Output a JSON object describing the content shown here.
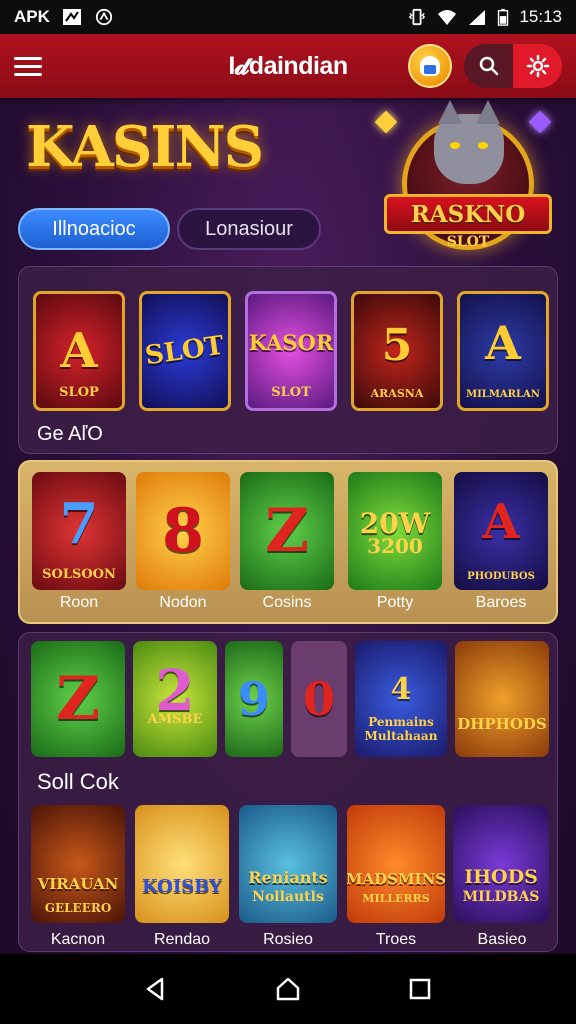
{
  "status_bar": {
    "carrier": "APK",
    "time": "15:13"
  },
  "app_bar": {
    "brand": "I𝓭daindian"
  },
  "hero": {
    "title": "KASINS",
    "tabs": [
      {
        "label": "Illnoacioc",
        "active": true
      },
      {
        "label": "Lonasiour",
        "active": false
      }
    ],
    "emblem": {
      "banner": "RASKNO",
      "sub": "SLOT"
    }
  },
  "row1": {
    "tiles": [
      {
        "main": "A",
        "sub": "SLOP"
      },
      {
        "main": "SLOT",
        "sub": ""
      },
      {
        "main": "KASOR",
        "sub": "SLOT"
      },
      {
        "main": "5",
        "sub": "ARASNA"
      },
      {
        "main": "A",
        "sub": "MILMARLAN"
      }
    ],
    "label": "Ge AľO"
  },
  "row2": {
    "tiles": [
      {
        "main": "7",
        "sub": "SOLSOON",
        "caption": "Roon"
      },
      {
        "main": "8",
        "sub": "",
        "caption": "Nodon"
      },
      {
        "main": "Z",
        "sub": "",
        "caption": "Cosins"
      },
      {
        "main": "20W",
        "sub": "3200",
        "caption": "Potty"
      },
      {
        "main": "A",
        "sub": "PHODUBOS",
        "caption": "Baroes"
      }
    ]
  },
  "row3": {
    "tiles": [
      {
        "main": "Z",
        "sub": ""
      },
      {
        "main": "2",
        "sub": "AMSBE"
      },
      {
        "main": "9",
        "sub": ""
      },
      {
        "main": "0",
        "sub": ""
      },
      {
        "main": "4",
        "sub": "Penmains Multahaan"
      },
      {
        "main": "",
        "sub": "DHPHODS"
      }
    ],
    "label": "Soll Cok"
  },
  "row4": {
    "tiles": [
      {
        "main": "VIRAUAN",
        "sub": "GELEERO",
        "caption": "Kacnon"
      },
      {
        "main": "KOISBY",
        "sub": "",
        "caption": "Rendao"
      },
      {
        "main": "Reniants",
        "sub": "Nollautls",
        "caption": "Rosieo"
      },
      {
        "main": "MADSMINS",
        "sub": "MILLERRS",
        "caption": "Troes"
      },
      {
        "main": "IHODS",
        "sub": "MILDBAS",
        "caption": "Basieo"
      }
    ]
  },
  "colors": {
    "app_bar": "#b0121e",
    "accent_gold": "#ffcf3a",
    "tab_active": "#2f7cf0"
  }
}
